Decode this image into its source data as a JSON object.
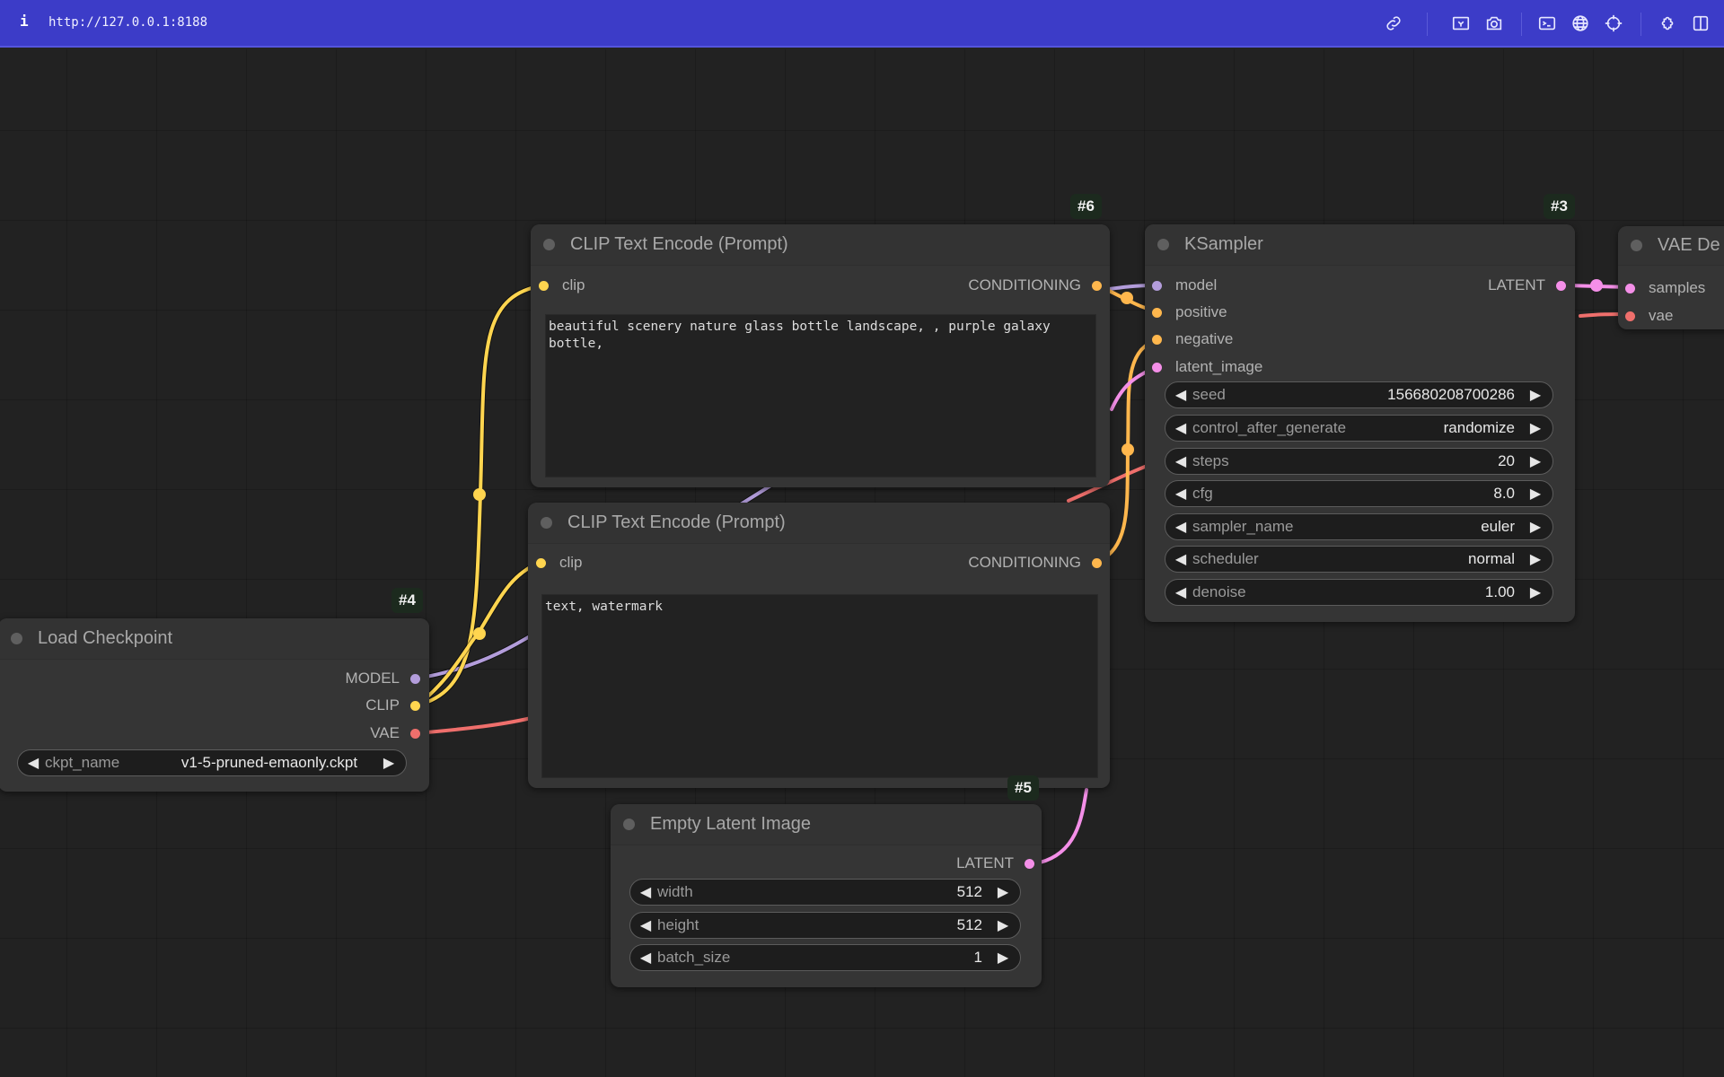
{
  "topbar": {
    "info_icon": "i",
    "url": "http://127.0.0.1:8188",
    "icons": [
      "link-icon",
      "image-icon",
      "camera-icon",
      "terminal-icon",
      "globe-icon",
      "crosshair-icon",
      "puzzle-icon",
      "split-panel-icon"
    ]
  },
  "colors": {
    "topbar": "#3c3cc8",
    "model": "#b39ddb",
    "clip": "#ffd54f",
    "conditioning": "#ffb74d",
    "latent": "#f48fe8",
    "vae": "#ef6f6c"
  },
  "nodes": {
    "clip_pos": {
      "id": "#6",
      "title": "CLIP Text Encode (Prompt)",
      "inputs": [
        "clip"
      ],
      "outputs": [
        "CONDITIONING"
      ],
      "text": "beautiful scenery nature glass bottle landscape, , purple galaxy bottle,"
    },
    "clip_neg": {
      "id": "#7",
      "title": "CLIP Text Encode (Prompt)",
      "inputs": [
        "clip"
      ],
      "outputs": [
        "CONDITIONING"
      ],
      "text": "text, watermark"
    },
    "ksampler": {
      "id": "#3",
      "title": "KSampler",
      "inputs": [
        "model",
        "positive",
        "negative",
        "latent_image"
      ],
      "outputs": [
        "LATENT"
      ],
      "widgets": [
        {
          "label": "seed",
          "value": "156680208700286"
        },
        {
          "label": "control_after_generate",
          "value": "randomize"
        },
        {
          "label": "steps",
          "value": "20"
        },
        {
          "label": "cfg",
          "value": "8.0"
        },
        {
          "label": "sampler_name",
          "value": "euler"
        },
        {
          "label": "scheduler",
          "value": "normal"
        },
        {
          "label": "denoise",
          "value": "1.00"
        }
      ]
    },
    "checkpoint": {
      "id": "#4",
      "title": "Load Checkpoint",
      "outputs": [
        "MODEL",
        "CLIP",
        "VAE"
      ],
      "widgets": [
        {
          "label": "ckpt_name",
          "value": "v1-5-pruned-emaonly.ckpt"
        }
      ]
    },
    "latent": {
      "id": "#5",
      "title": "Empty Latent Image",
      "outputs": [
        "LATENT"
      ],
      "widgets": [
        {
          "label": "width",
          "value": "512"
        },
        {
          "label": "height",
          "value": "512"
        },
        {
          "label": "batch_size",
          "value": "1"
        }
      ]
    },
    "vae_decode": {
      "title": "VAE De",
      "inputs": [
        "samples",
        "vae"
      ]
    }
  },
  "arrows": {
    "left": "◀",
    "right": "▶"
  }
}
